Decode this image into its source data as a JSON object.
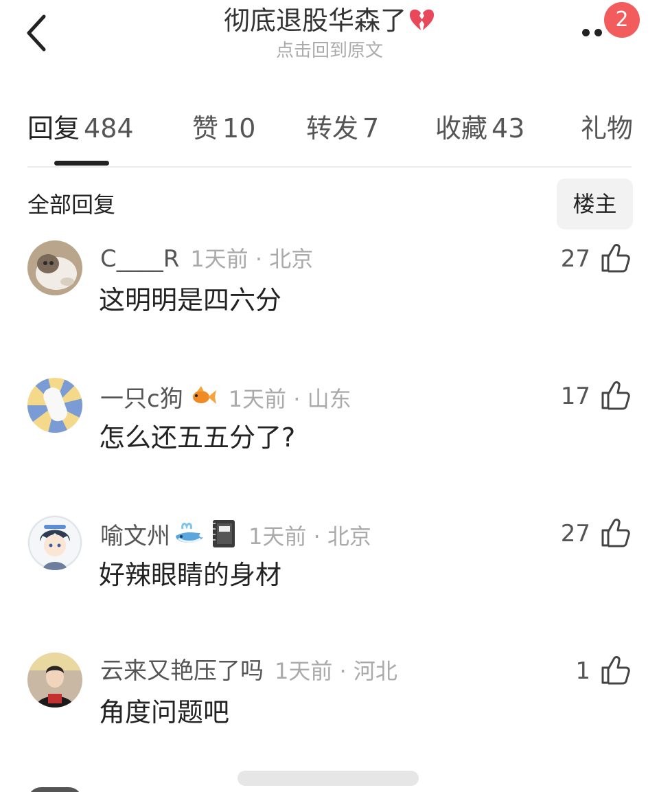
{
  "header": {
    "title": "彻底退股华森了",
    "subtitle": "点击回到原文",
    "notification_count": "2"
  },
  "tabs": [
    {
      "label": "回复",
      "count": "484",
      "active": true
    },
    {
      "label": "赞",
      "count": "10",
      "active": false
    },
    {
      "label": "转发",
      "count": "7",
      "active": false
    },
    {
      "label": "收藏",
      "count": "43",
      "active": false
    },
    {
      "label": "礼物",
      "count": "",
      "active": false
    }
  ],
  "section": {
    "title": "全部回复",
    "filter_label": "楼主"
  },
  "comments": [
    {
      "username": "C____R",
      "emoji": "",
      "time": "1天前",
      "location": "北京",
      "text": "这明明是四六分",
      "likes": "27"
    },
    {
      "username": "一只c狗",
      "emoji": "goldfish-emoji",
      "time": "1天前",
      "location": "山东",
      "text": "怎么还五五分了?",
      "likes": "17"
    },
    {
      "username": "喻文州",
      "emoji": "whale-notebook-emoji",
      "time": "1天前",
      "location": "北京",
      "text": "好辣眼睛的身材",
      "likes": "27"
    },
    {
      "username": "云来又艳压了吗",
      "emoji": "",
      "time": "1天前",
      "location": "河北",
      "text": "角度问题吧",
      "likes": "1"
    }
  ],
  "colors": {
    "badge": "#f25c5c",
    "heart": "#e8485a",
    "muted_text": "#aaaaaa",
    "tab_indicator": "#222222"
  }
}
